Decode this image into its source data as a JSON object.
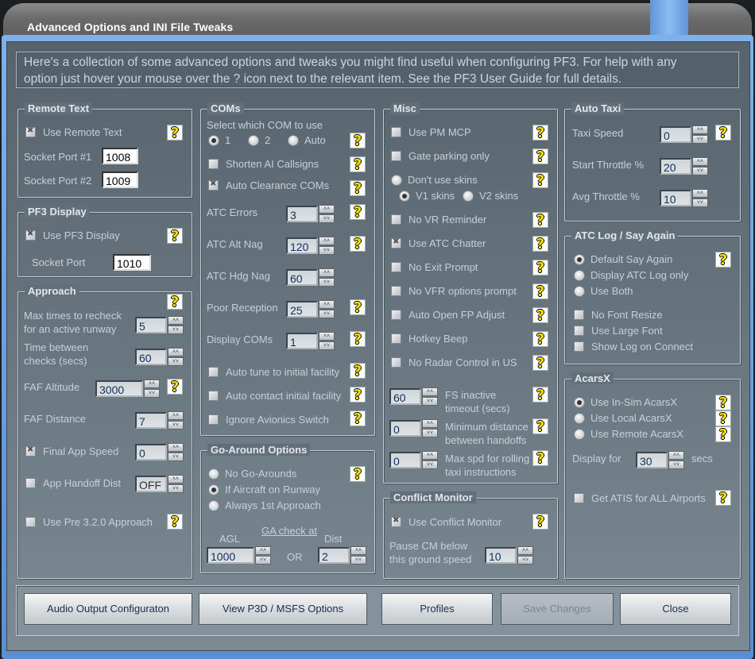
{
  "window": {
    "title": "Advanced Options and INI File Tweaks"
  },
  "intro": "Here's a collection of some advanced options and tweaks you might find useful when configuring PF3. For help with any\noption just hover your mouse over the ? icon next to the relevant item. See the PF3 User Guide for full details.",
  "remote_text": {
    "title": "Remote Text",
    "use_remote_text": {
      "label": "Use Remote Text",
      "checked": true
    },
    "socket1": {
      "label": "Socket Port #1",
      "value": "1008"
    },
    "socket2": {
      "label": "Socket Port #2",
      "value": "1009"
    }
  },
  "pf3_display": {
    "title": "PF3 Display",
    "use_pf3_display": {
      "label": "Use PF3 Display",
      "checked": true
    },
    "socket": {
      "label": "Socket Port",
      "value": "1010"
    }
  },
  "approach": {
    "title": "Approach",
    "max_recheck": {
      "label": "Max times to recheck\nfor an active runway",
      "value": "5"
    },
    "time_between": {
      "label": "Time between\nchecks (secs)",
      "value": "60"
    },
    "faf_altitude": {
      "label": "FAF Altitude",
      "value": "3000"
    },
    "faf_distance": {
      "label": "FAF Distance",
      "value": "7"
    },
    "final_app_speed": {
      "label": "Final App Speed",
      "checked": true,
      "value": "0"
    },
    "app_handoff": {
      "label": "App Handoff Dist",
      "checked": false,
      "value": "OFF",
      "disabled": true
    },
    "pre_320": {
      "label": "Use Pre 3.2.0 Approach",
      "checked": false
    }
  },
  "coms": {
    "title": "COMs",
    "select_label": "Select which COM to use",
    "com1": {
      "label": "1",
      "checked": true
    },
    "com2": {
      "label": "2",
      "checked": false
    },
    "com_auto": {
      "label": "Auto",
      "checked": false
    },
    "shorten_ai": {
      "label": "Shorten AI Callsigns",
      "checked": false
    },
    "auto_clearance": {
      "label": "Auto Clearance COMs",
      "checked": true
    },
    "atc_errors": {
      "label": "ATC Errors",
      "value": "3"
    },
    "atc_alt_nag": {
      "label": "ATC Alt Nag",
      "value": "120"
    },
    "atc_hdg_nag": {
      "label": "ATC Hdg Nag",
      "value": "60"
    },
    "poor_reception": {
      "label": "Poor Reception",
      "value": "25"
    },
    "display_coms": {
      "label": "Display COMs",
      "value": "1"
    },
    "auto_tune": {
      "label": "Auto tune to initial facility",
      "checked": false
    },
    "auto_contact": {
      "label": "Auto contact initial facility",
      "checked": false
    },
    "ignore_avionics": {
      "label": "Ignore Avionics Switch",
      "checked": false
    }
  },
  "go_around": {
    "title": "Go-Around Options",
    "none": {
      "label": "No Go-Arounds",
      "checked": false
    },
    "if_aircraft": {
      "label": "If Aircraft on Runway",
      "checked": true
    },
    "always_first": {
      "label": "Always 1st Approach",
      "checked": false
    },
    "ga_check_at": "GA check at",
    "agl": {
      "label": "AGL",
      "value": "1000"
    },
    "or_label": "OR",
    "dist": {
      "label": "Dist",
      "value": "2"
    }
  },
  "misc": {
    "title": "Misc",
    "use_pm_mcp": {
      "label": "Use PM MCP",
      "checked": false
    },
    "gate_parking": {
      "label": "Gate parking only",
      "checked": false
    },
    "dont_use_skins": {
      "label": "Don't use skins",
      "checked": false
    },
    "v1_skins": {
      "label": "V1 skins",
      "checked": true
    },
    "v2_skins": {
      "label": "V2 skins",
      "checked": false
    },
    "no_vr_reminder": {
      "label": "No VR Reminder",
      "checked": false
    },
    "use_atc_chatter": {
      "label": "Use ATC Chatter",
      "checked": true
    },
    "no_exit_prompt": {
      "label": "No Exit Prompt",
      "checked": false
    },
    "no_vfr_prompt": {
      "label": "No VFR options  prompt",
      "checked": false
    },
    "auto_open_fp": {
      "label": "Auto Open FP Adjust",
      "checked": false
    },
    "hotkey_beep": {
      "label": "Hotkey Beep",
      "checked": false
    },
    "no_radar_us": {
      "label": "No Radar Control in US",
      "checked": false
    },
    "fs_inactive": {
      "label": "FS inactive\ntimeout (secs)",
      "value": "60"
    },
    "min_distance": {
      "label": "Minimum distance\nbetween handoffs",
      "value": "0"
    },
    "max_spd": {
      "label": "Max spd for rolling\ntaxi instructions",
      "value": "0"
    }
  },
  "conflict_monitor": {
    "title": "Conflict Monitor",
    "use": {
      "label": "Use Conflict Monitor",
      "checked": true
    },
    "pause": {
      "label": "Pause CM below\nthis ground speed",
      "value": "10"
    }
  },
  "auto_taxi": {
    "title": "Auto Taxi",
    "taxi_speed": {
      "label": "Taxi Speed",
      "value": "0"
    },
    "start_throttle": {
      "label": "Start Throttle %",
      "value": "20"
    },
    "avg_throttle": {
      "label": "Avg Throttle  %",
      "value": "10"
    }
  },
  "atc_log": {
    "title": "ATC Log / Say Again",
    "default_say_again": {
      "label": "Default Say Again",
      "checked": true
    },
    "display_log_only": {
      "label": "Display ATC Log only",
      "checked": false
    },
    "use_both": {
      "label": "Use Both",
      "checked": false
    },
    "no_font_resize": {
      "label": "No Font Resize",
      "checked": false
    },
    "large_font": {
      "label": "Use Large Font",
      "checked": false
    },
    "show_on_connect": {
      "label": "Show Log on Connect",
      "checked": false
    }
  },
  "acarsx": {
    "title": "AcarsX",
    "in_sim": {
      "label": "Use In-Sim AcarsX",
      "checked": true
    },
    "local": {
      "label": "Use Local AcarsX",
      "checked": false
    },
    "remote": {
      "label": "Use Remote AcarsX",
      "checked": false
    },
    "display_for": {
      "label": "Display for",
      "value": "30",
      "unit": "secs"
    },
    "get_atis": {
      "label": "Get ATIS for ALL Airports",
      "checked": false
    }
  },
  "buttons": {
    "audio": {
      "label": "Audio Output Configuraton"
    },
    "view_options": {
      "label": "View P3D / MSFS Options"
    },
    "profiles": {
      "label": "Profiles"
    },
    "save": {
      "label": "Save Changes",
      "disabled": true
    },
    "close": {
      "label": "Close"
    }
  },
  "icons": {
    "help": "help-question-icon",
    "spin_up": "chevron-up-icon",
    "spin_down": "chevron-down-icon"
  },
  "colors": {
    "help_icon": "#f5e000",
    "frame_accent": "#7fb0ea",
    "panel": "#5f6c76"
  }
}
